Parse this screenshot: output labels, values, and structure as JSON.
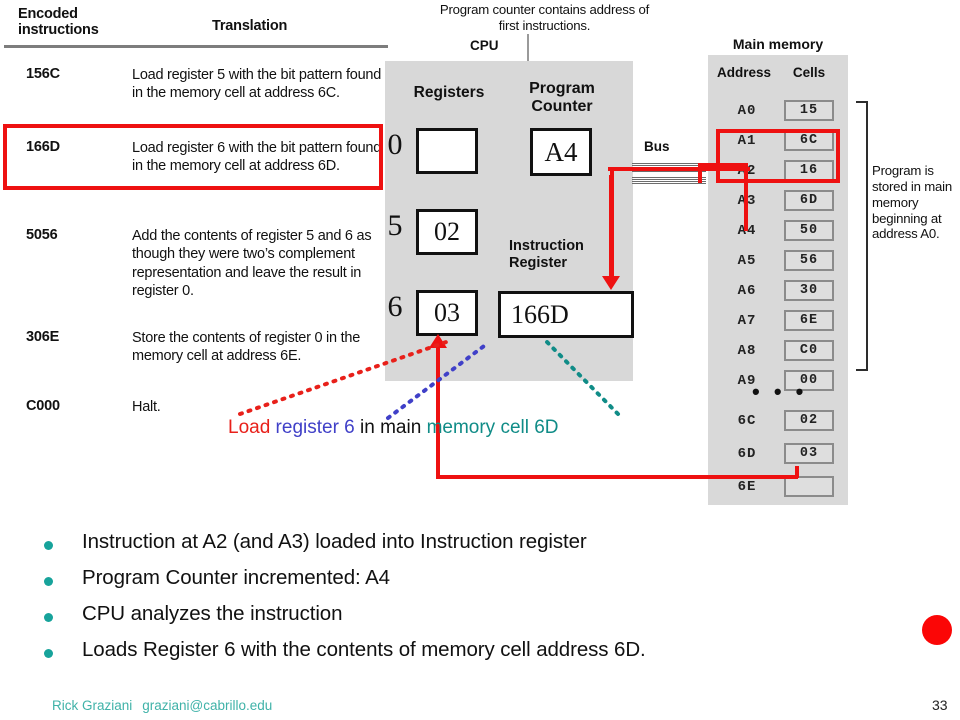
{
  "instruction_table": {
    "header": {
      "col1": "Encoded\ninstructions",
      "col2": "Translation"
    },
    "rows": [
      {
        "code": "156C",
        "translation": "Load register 5 with the bit pattern found in the memory cell at address 6C.",
        "highlighted": false
      },
      {
        "code": "166D",
        "translation": "Load register 6 with the bit pattern found in the memory cell at address 6D.",
        "highlighted": true
      },
      {
        "code": "5056",
        "translation": "Add the contents of register 5 and 6 as though they were two’s complement representation and leave the result in register 0.",
        "highlighted": false
      },
      {
        "code": "306E",
        "translation": "Store the contents of register 0 in the memory cell at address 6E.",
        "highlighted": false
      },
      {
        "code": "C000",
        "translation": "Halt.",
        "highlighted": false
      }
    ]
  },
  "cpu": {
    "label": "CPU",
    "pc_note": "Program counter contains address of first instructions.",
    "registers_label": "Registers",
    "program_counter_label": "Program\nCounter",
    "instruction_register_label": "Instruction\nRegister",
    "program_counter_value": "A4",
    "instruction_register_value": "166D",
    "registers": [
      {
        "num": "0",
        "value": ""
      },
      {
        "num": "5",
        "value": "02"
      },
      {
        "num": "6",
        "value": "03"
      }
    ]
  },
  "bus": {
    "label": "Bus"
  },
  "memory": {
    "title": "Main memory",
    "col_address": "Address",
    "col_cells": "Cells",
    "ellipsis": "• • •",
    "note": "Program is stored in main memory beginning at address A0.",
    "rows": [
      {
        "address": "A0",
        "cell": "15",
        "highlighted": false
      },
      {
        "address": "A1",
        "cell": "6C",
        "highlighted": false
      },
      {
        "address": "A2",
        "cell": "16",
        "highlighted": true
      },
      {
        "address": "A3",
        "cell": "6D",
        "highlighted": true
      },
      {
        "address": "A4",
        "cell": "50",
        "highlighted": false
      },
      {
        "address": "A5",
        "cell": "56",
        "highlighted": false
      },
      {
        "address": "A6",
        "cell": "30",
        "highlighted": false
      },
      {
        "address": "A7",
        "cell": "6E",
        "highlighted": false
      },
      {
        "address": "A8",
        "cell": "C0",
        "highlighted": false
      },
      {
        "address": "A9",
        "cell": "00",
        "highlighted": false
      }
    ],
    "tail_rows": [
      {
        "address": "6C",
        "cell": "02"
      },
      {
        "address": "6D",
        "cell": "03"
      },
      {
        "address": "6E",
        "cell": ""
      }
    ]
  },
  "caption": {
    "part_load": "Load ",
    "part_register": "register 6",
    "part_middle": " in main ",
    "part_memory": "memory cell 6D"
  },
  "bullets": [
    "Instruction at A2 (and A3) loaded into Instruction register",
    "Program Counter incremented: A4",
    "CPU analyzes the instruction",
    "Loads Register 6 with the contents of memory cell address 6D."
  ],
  "footer": {
    "author": "Rick Graziani",
    "email": "graziani@cabrillo.edu",
    "page": "33"
  },
  "colors": {
    "red": "#ee1111",
    "teal": "#17a39b",
    "blue": "#4040c8",
    "caption_red": "#e8201a",
    "caption_teal": "#108c87",
    "panel_gray": "#d8d8d8"
  }
}
